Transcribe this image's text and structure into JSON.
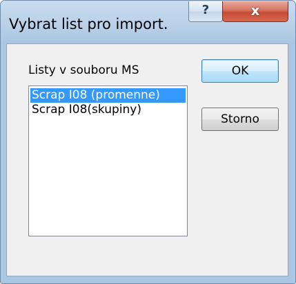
{
  "window": {
    "title": "Vybrat list pro import.",
    "help_glyph": "?",
    "close_glyph": "x",
    "help_icon": "question-mark-icon",
    "close_icon": "close-x-icon"
  },
  "dialog": {
    "list_label": "Listy v souboru MS",
    "sheets": [
      {
        "label": "Scrap I08 (promenne)",
        "selected": true
      },
      {
        "label": "Scrap I08(skupiny)",
        "selected": false
      }
    ],
    "ok_label": "OK",
    "cancel_label": "Storno"
  },
  "colors": {
    "selection": "#3399ff",
    "close_button": "#c54b33",
    "titlebar": "#b7cfe7"
  }
}
